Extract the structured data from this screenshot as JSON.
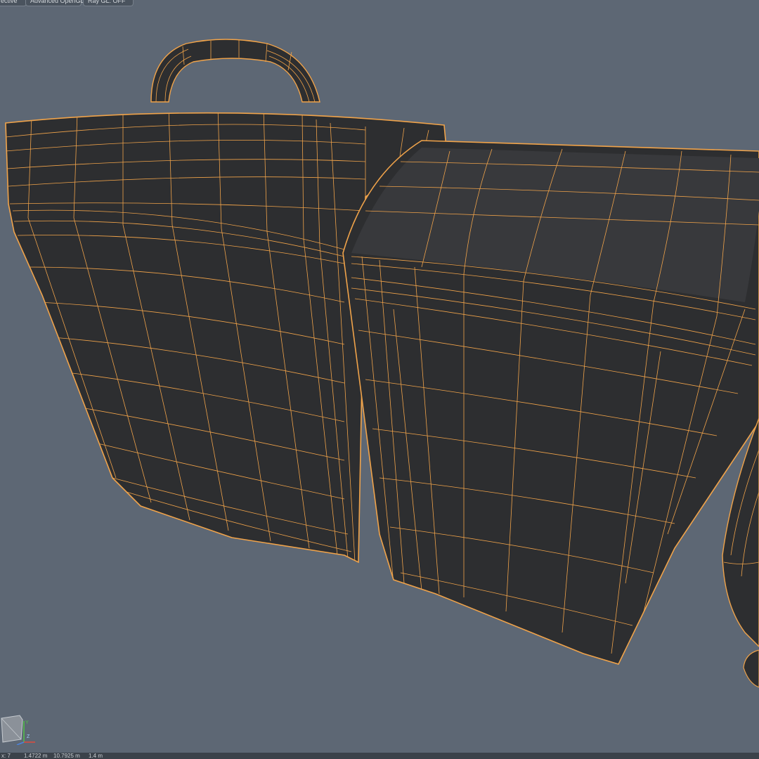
{
  "viewport": {
    "view_label": "ective",
    "render_mode": "Advanced OpenGL",
    "ray_gl": "Ray GL: OFF"
  },
  "status": {
    "coord_x": "x: 7",
    "coord_a": "1.4722 m",
    "coord_b": "10.7925 m",
    "coord_c": "1.4 m"
  },
  "colors": {
    "background": "#5d6774",
    "wire": "#f0a34a",
    "mesh_fill": "#2d2e30"
  },
  "gizmo": {
    "axis_x": "X",
    "axis_y": "Y",
    "axis_z": "Z"
  }
}
